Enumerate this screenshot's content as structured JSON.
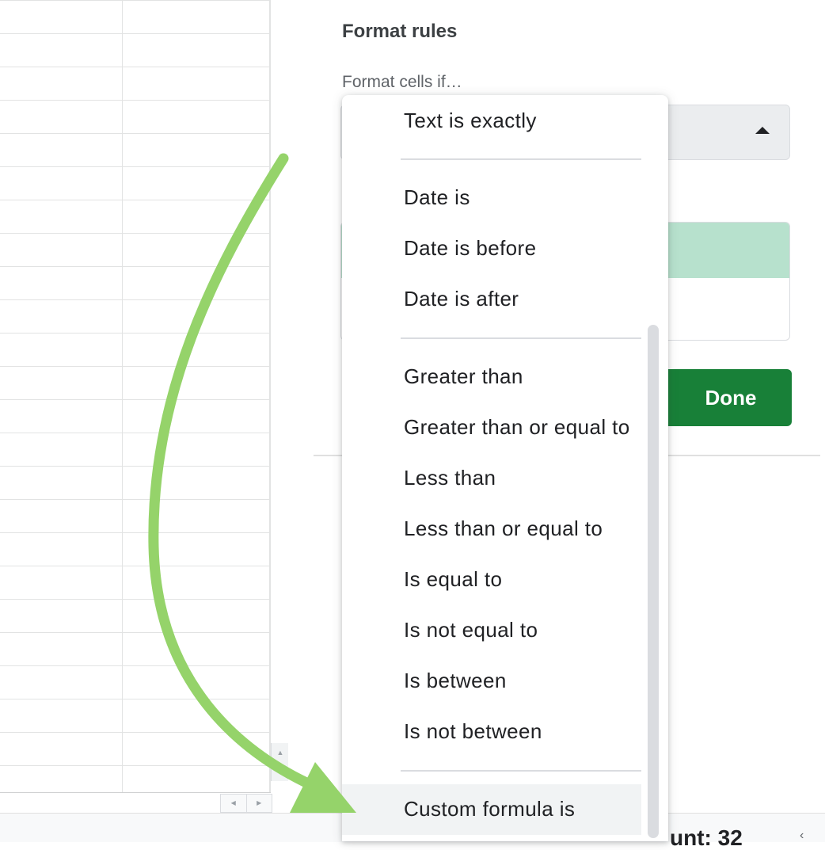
{
  "panel": {
    "title": "Format rules",
    "format_cells_label": "Format cells if…",
    "done_label": "Done"
  },
  "dropdown": {
    "items": [
      "Text is exactly",
      "Date is",
      "Date is before",
      "Date is after",
      "Greater than",
      "Greater than or equal to",
      "Less than",
      "Less than or equal to",
      "Is equal to",
      "Is not equal to",
      "Is between",
      "Is not between",
      "Custom formula is"
    ],
    "highlighted_item": "Custom formula is"
  },
  "statusbar": {
    "count_text": "unt: 32"
  },
  "colors": {
    "done_button": "#188038",
    "style_preview": "#b7e1cd",
    "arrow": "#95d36a"
  },
  "icons": {
    "select_arrow": "caret-up-icon",
    "scroll_left": "chevron-left-icon",
    "scroll_right": "chevron-right-icon",
    "scroll_up": "caret-up-icon",
    "status_chevron": "chevron-left-icon"
  }
}
